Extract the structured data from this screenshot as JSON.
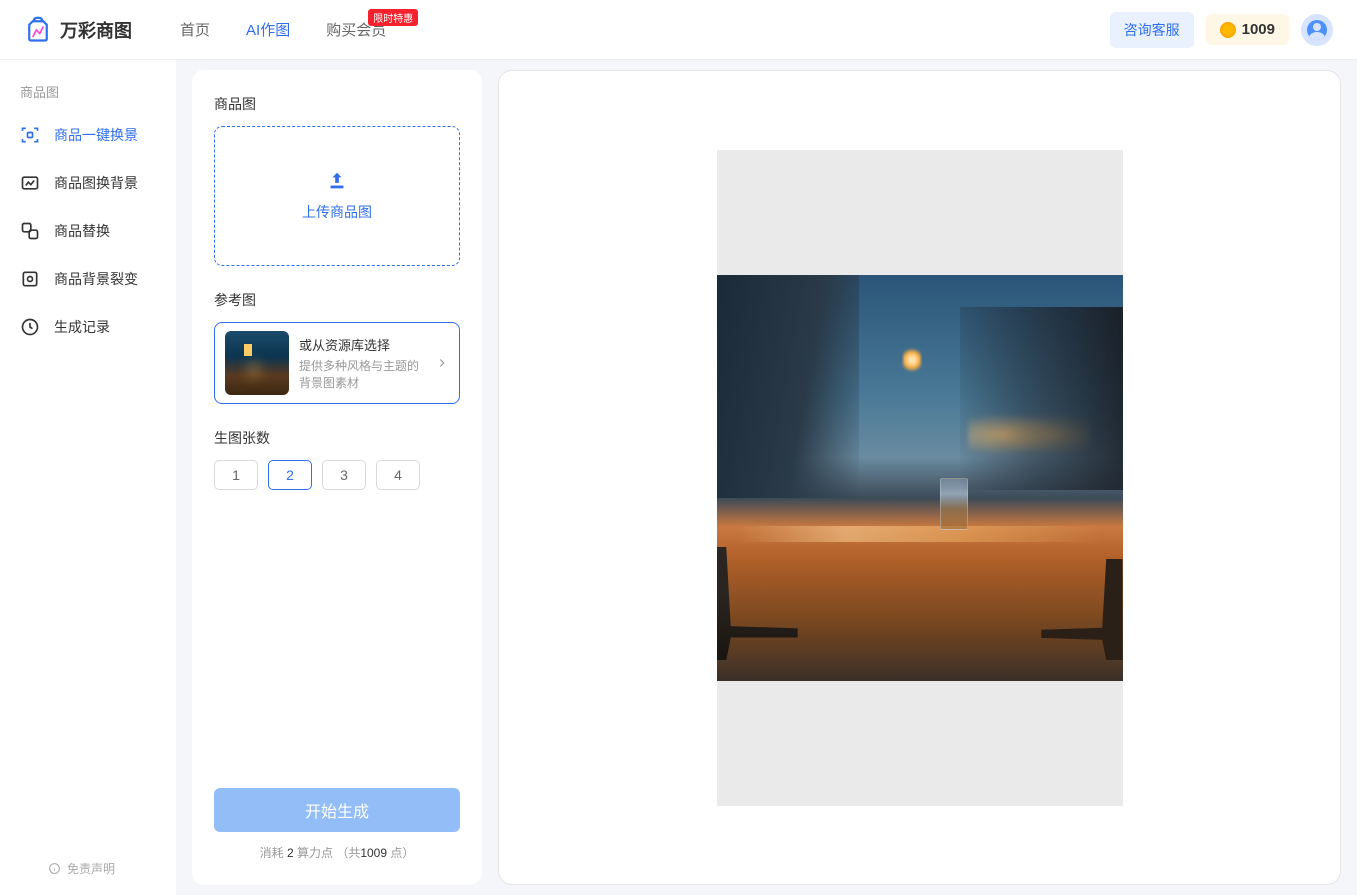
{
  "header": {
    "logo_text": "万彩商图",
    "nav": [
      {
        "label": "首页",
        "active": false
      },
      {
        "label": "AI作图",
        "active": true
      },
      {
        "label": "购买会员",
        "active": false,
        "badge": "限时特惠"
      }
    ],
    "cs_button": "咨询客服",
    "points": "1009"
  },
  "sidebar": {
    "group_label": "商品图",
    "items": [
      {
        "label": "商品一键换景",
        "active": true
      },
      {
        "label": "商品图换背景",
        "active": false
      },
      {
        "label": "商品替换",
        "active": false
      },
      {
        "label": "商品背景裂变",
        "active": false
      },
      {
        "label": "生成记录",
        "active": false
      }
    ],
    "disclaimer": "免责声明"
  },
  "panel": {
    "section_product_label": "商品图",
    "upload_text": "上传商品图",
    "section_ref_label": "参考图",
    "ref_title": "或从资源库选择",
    "ref_sub": "提供多种风格与主题的背景图素材",
    "section_count_label": "生图张数",
    "counts": [
      "1",
      "2",
      "3",
      "4"
    ],
    "count_active_idx": 1,
    "generate_button": "开始生成",
    "cost_prefix": "消耗 ",
    "cost_num": "2",
    "cost_mid": " 算力点 （共",
    "cost_total": "1009",
    "cost_suffix": " 点）"
  }
}
